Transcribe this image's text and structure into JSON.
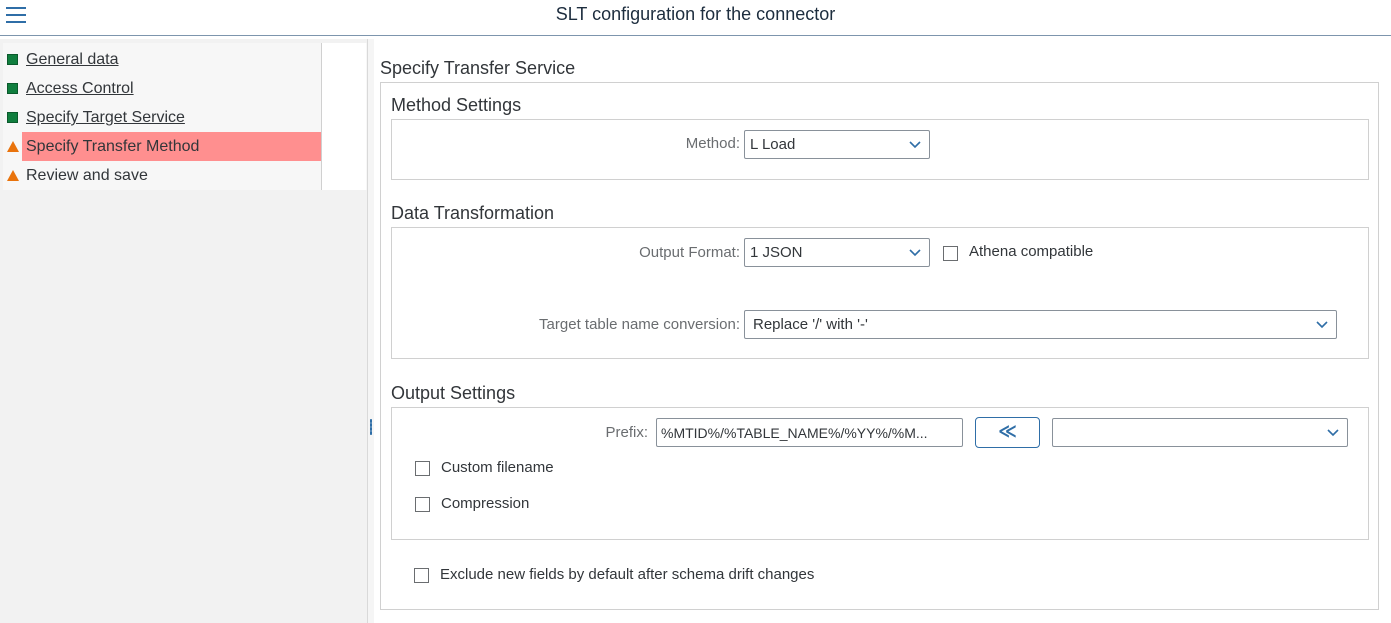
{
  "header": {
    "title": "SLT configuration for the connector"
  },
  "nav": {
    "items": [
      {
        "label": "General data",
        "status": "complete"
      },
      {
        "label": "Access Control",
        "status": "complete"
      },
      {
        "label": "Specify Target  Service",
        "status": "complete"
      },
      {
        "label": "Specify Transfer Method",
        "status": "warning",
        "active": true
      },
      {
        "label": "Review and save",
        "status": "warning"
      }
    ]
  },
  "content": {
    "title": "Specify Transfer Service",
    "method_settings": {
      "title": "Method Settings",
      "method_label": "Method:",
      "method_value": "L Load"
    },
    "data_transformation": {
      "title": "Data Transformation",
      "output_format_label": "Output Format:",
      "output_format_value": "1 JSON",
      "athena_label": "Athena compatible",
      "athena_checked": false,
      "table_name_label": "Target table name conversion:",
      "table_name_value": "Replace '/' with '-'"
    },
    "output_settings": {
      "title": "Output Settings",
      "prefix_label": "Prefix:",
      "prefix_value": "%MTID%/%TABLE_NAME%/%YY%/%M...",
      "insert_button": "≪",
      "prefix_select_value": "",
      "custom_filename_label": "Custom filename",
      "custom_filename_checked": false,
      "compression_label": "Compression",
      "compression_checked": false
    },
    "exclude_label": "Exclude new fields by default after schema drift changes",
    "exclude_checked": false
  },
  "colors": {
    "complete": "#107e3e",
    "warning": "#e9730c",
    "active_highlight": "#ff8f8f",
    "accent": "#2f6ea7"
  }
}
